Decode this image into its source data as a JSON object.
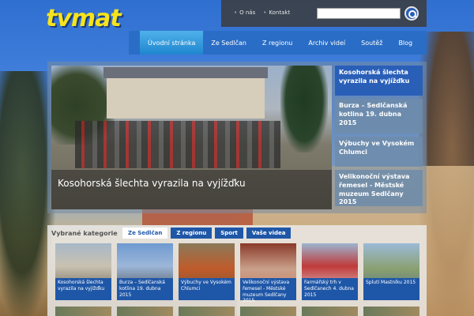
{
  "site": {
    "logo": "tvmat"
  },
  "toplinks": [
    "O nás",
    "Kontakt"
  ],
  "search": {
    "placeholder": ""
  },
  "nav": [
    "Úvodní stránka",
    "Ze Sedlčan",
    "Z regionu",
    "Archiv videí",
    "Soutěž",
    "Blog"
  ],
  "hero": {
    "caption": "Kosohorská šlechta vyrazila na vyjížďku"
  },
  "sidebar": [
    "Kosohorská šlechta vyrazila na vyjížďku",
    "Burza – Sedlčanská kotlina 19. dubna 2015",
    "Výbuchy ve Vysokém Chlumci",
    "Velikonoční výstava řemesel - Městské muzeum Sedlčany 2015"
  ],
  "categories": {
    "title": "Vybrané kategorie",
    "tabs": [
      "Ze Sedlčan",
      "Z regionu",
      "Sport",
      "Vaše videa"
    ],
    "cards": [
      "Kosohorská šlechta vyrazila na vyjížďku",
      "Burza – Sedlčanská kotlina 19. dubna 2015",
      "Výbuchy ve Vysokém Chlumci",
      "Velikonoční výstava řemesel - Městské muzeum Sedlčany 2015",
      "Farmářský trh v Sedlčanech 4. dubna 2015",
      "Splutí Mastníku 2015"
    ]
  },
  "colors": {
    "accent": "#2a6dc6",
    "logo": "#f6e31d",
    "card_label": "#1f57a8"
  }
}
